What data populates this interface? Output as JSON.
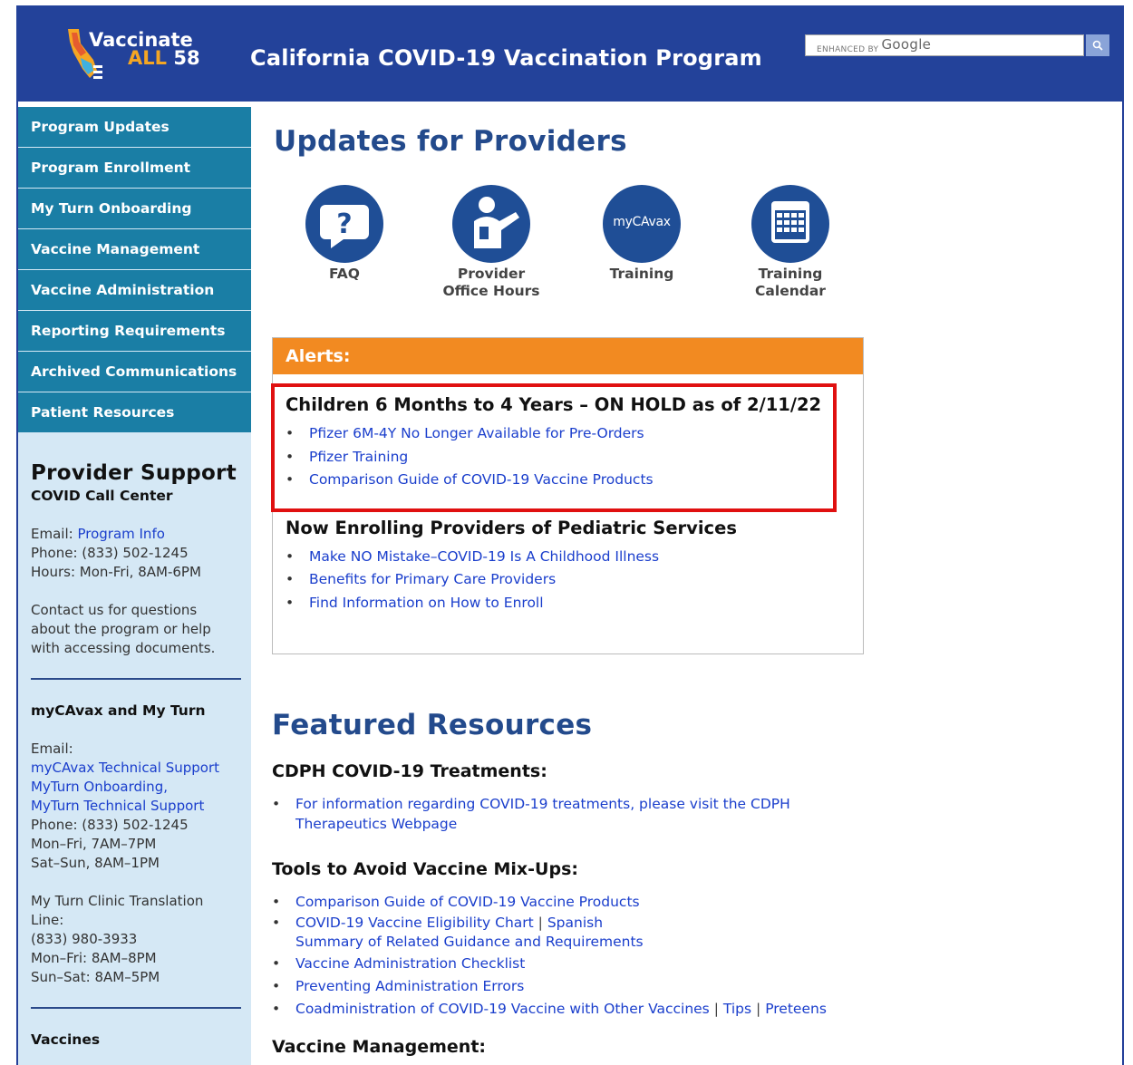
{
  "header": {
    "logo_line1": "Vaccinate",
    "logo_all": "ALL",
    "logo_num": "58",
    "site_title": "California COVID-19 Vaccination Program",
    "search_placeholder_small": "ENHANCED BY",
    "search_placeholder_brand": "Google"
  },
  "sidebar": {
    "nav": [
      {
        "label": "Program Updates"
      },
      {
        "label": "Program Enrollment"
      },
      {
        "label": "My Turn Onboarding"
      },
      {
        "label": "Vaccine Management"
      },
      {
        "label": "Vaccine Administration"
      },
      {
        "label": "Reporting Requirements"
      },
      {
        "label": "Archived Communications"
      },
      {
        "label": "Patient Resources"
      }
    ],
    "support_title": "Provider Support",
    "call_center_title": "COVID Call Center",
    "call_email_label": "Email:",
    "call_email_link": "Program Info",
    "call_phone": "Phone: (833) 502-1245",
    "call_hours": "Hours: Mon-Fri, 8AM-6PM",
    "contact_text": "Contact us for questions about the program or help with accessing documents.",
    "mycavax_title": "myCAvax and My Turn",
    "mycavax_email_label": "Email:",
    "mycavax_link1": "myCAvax Technical Support",
    "mycavax_link2": "MyTurn Onboarding,",
    "mycavax_link3": "MyTurn Technical Support",
    "mycavax_phone": "Phone: (833) 502-1245",
    "mycavax_hours1": "Mon–Fri, 7AM–7PM",
    "mycavax_hours2": "Sat–Sun, 8AM–1PM",
    "translation_title": "My Turn Clinic Translation Line:",
    "translation_phone": "(833) 980-3933",
    "translation_hours1": "Mon–Fri: 8AM–8PM",
    "translation_hours2": "Sun–Sat: 8AM–5PM",
    "vaccines_title": "Vaccines"
  },
  "main": {
    "updates_title": "Updates for Providers",
    "icons": [
      {
        "label": "FAQ",
        "icon": "question-icon"
      },
      {
        "label": "Provider Office Hours",
        "icon": "provider-icon"
      },
      {
        "label": "Training",
        "icon": "mycavax-icon",
        "badge": "myCAvax"
      },
      {
        "label": "Training Calendar",
        "icon": "calendar-icon"
      }
    ],
    "alerts": {
      "header": "Alerts:",
      "group1_title": "Children 6 Months to 4 Years – ON HOLD as of 2/11/22",
      "group1_links": [
        "Pfizer 6M-4Y No Longer Available for Pre-Orders",
        "Pfizer Training",
        "Comparison Guide of COVID-19 Vaccine Products"
      ],
      "group2_title": "Now Enrolling Providers of Pediatric Services",
      "group2_links": [
        "Make NO Mistake–COVID-19 Is A Childhood Illness",
        "Benefits for Primary Care Providers",
        "Find Information on How to Enroll"
      ]
    },
    "featured": {
      "title": "Featured Resources",
      "treatments_title": "CDPH COVID-19 Treatments:",
      "treatments_text": "For information regarding COVID-19 treatments, please visit the",
      "treatments_link": "CDPH Therapeutics Webpage",
      "mixups_title": "Tools to Avoid Vaccine Mix-Ups:",
      "mixups": {
        "l1": "Comparison Guide of COVID-19 Vaccine Products",
        "l2a": "COVID-19 Vaccine Eligibility Chart",
        "l2b": "Spanish",
        "l2c": "Summary of Related Guidance and Requirements",
        "l3": "Vaccine Administration Checklist",
        "l4": "Preventing Administration Errors",
        "l5a": "Coadministration of COVID-19 Vaccine with Other Vaccines",
        "l5b": "Tips",
        "l5c": "Preteens"
      },
      "management_title": "Vaccine Management:"
    }
  },
  "colors": {
    "header_bg": "#23429a",
    "nav_bg": "#1a7ea5",
    "sidebar_bg": "#d5e8f5",
    "alert_orange": "#f28a21",
    "highlight_red": "#e01010",
    "heading_blue": "#234a8c",
    "link_blue": "#1a3ecc"
  }
}
